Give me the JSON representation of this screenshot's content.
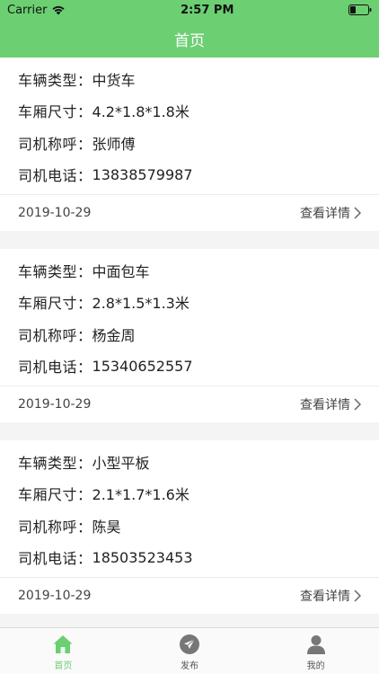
{
  "status_bar": {
    "carrier": "Carrier",
    "time": "2:57 PM"
  },
  "nav": {
    "title": "首页"
  },
  "cards": [
    {
      "type_label": "车辆类型：",
      "type_value": "中货车",
      "size_label": "车厢尺寸：",
      "size_value": "4.2*1.8*1.8米",
      "driver_label": "司机称呼：",
      "driver_value": "张师傅",
      "phone_label": "司机电话：",
      "phone_value": "13838579987",
      "date": "2019-10-29",
      "detail_label": "查看详情"
    },
    {
      "type_label": "车辆类型：",
      "type_value": "中面包车",
      "size_label": "车厢尺寸：",
      "size_value": "2.8*1.5*1.3米",
      "driver_label": "司机称呼：",
      "driver_value": "杨金周",
      "phone_label": "司机电话：",
      "phone_value": "15340652557",
      "date": "2019-10-29",
      "detail_label": "查看详情"
    },
    {
      "type_label": "车辆类型：",
      "type_value": "小型平板",
      "size_label": "车厢尺寸：",
      "size_value": "2.1*1.7*1.6米",
      "driver_label": "司机称呼：",
      "driver_value": "陈昊",
      "phone_label": "司机电话：",
      "phone_value": "18503523453",
      "date": "2019-10-29",
      "detail_label": "查看详情"
    }
  ],
  "tabbar": {
    "items": [
      {
        "label": "首页",
        "icon": "home-icon",
        "active": true
      },
      {
        "label": "发布",
        "icon": "send-icon",
        "active": false
      },
      {
        "label": "我的",
        "icon": "user-icon",
        "active": false
      }
    ]
  },
  "colors": {
    "accent": "#6ccf72",
    "background": "#f4f4f4",
    "card": "#ffffff"
  }
}
